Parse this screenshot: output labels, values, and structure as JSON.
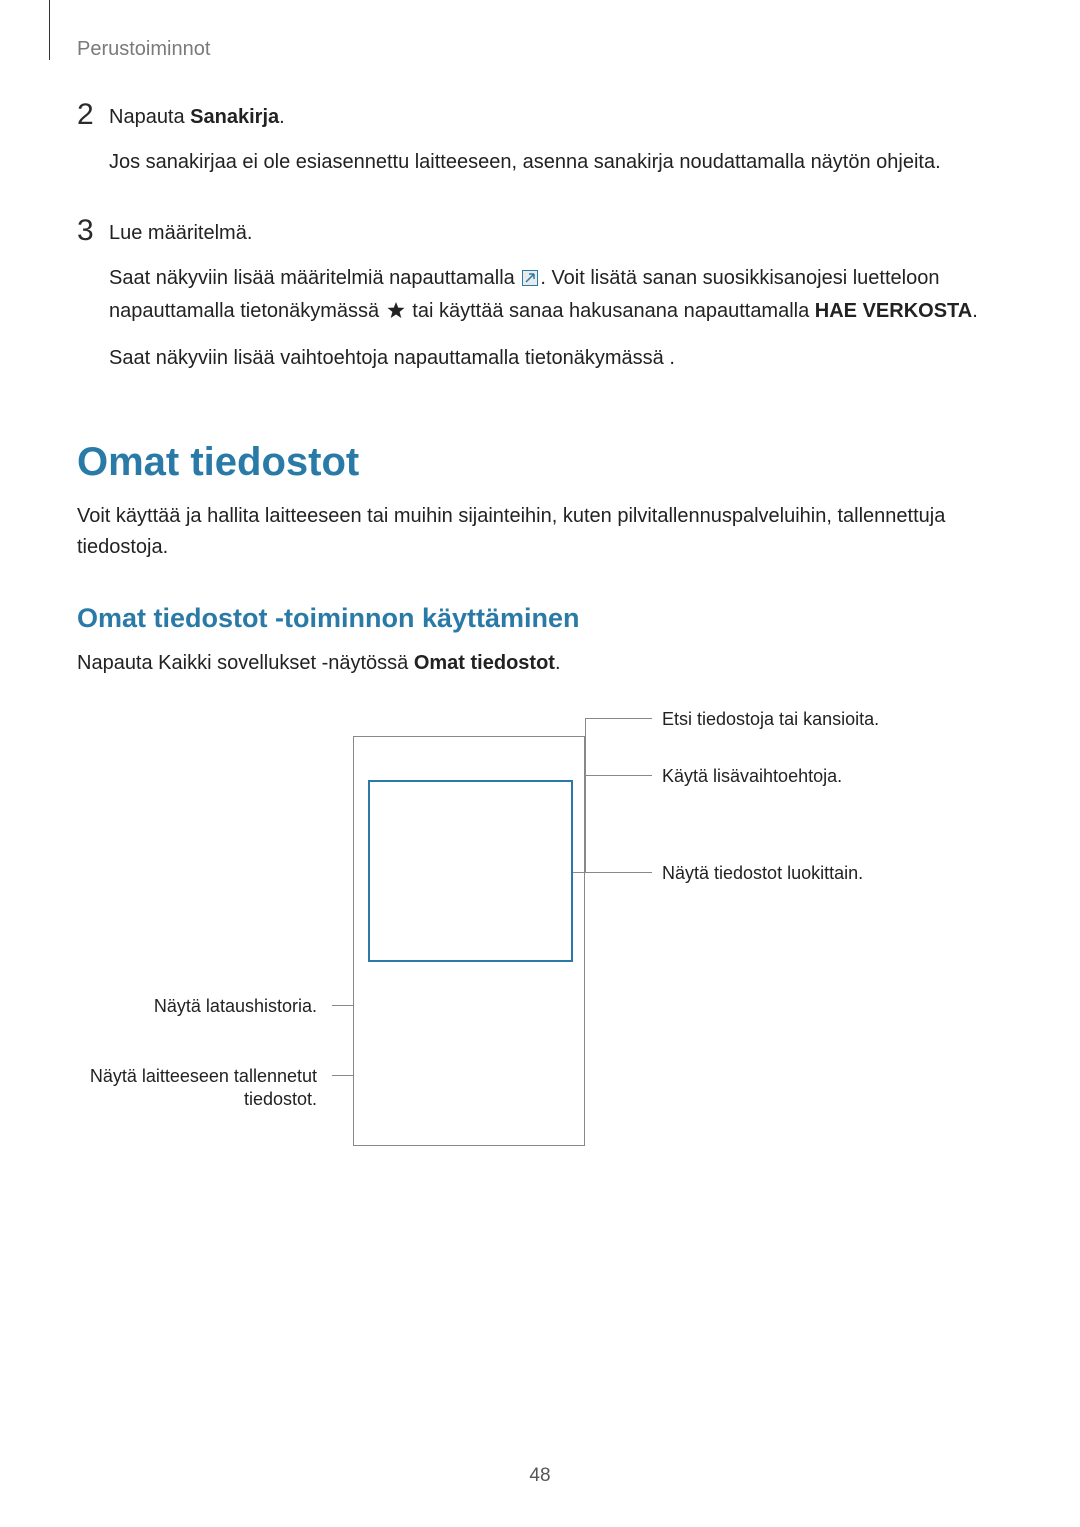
{
  "header": {
    "section": "Perustoiminnot"
  },
  "steps": [
    {
      "num": "2",
      "line1_pre": "Napauta ",
      "line1_bold": "Sanakirja",
      "line1_post": ".",
      "line2": "Jos sanakirjaa ei ole esiasennettu laitteeseen, asenna sanakirja noudattamalla näytön ohjeita."
    },
    {
      "num": "3",
      "line1": "Lue määritelmä.",
      "line2_a": "Saat näkyviin lisää määritelmiä napauttamalla ",
      "line2_b": ". Voit lisätä sanan suosikkisanojesi luetteloon napauttamalla tietonäkymässä ",
      "line2_c": " tai käyttää sanaa hakusanana napauttamalla ",
      "line2_bold": "HAE VERKOSTA",
      "line2_d": ".",
      "line3": "Saat näkyviin lisää vaihtoehtoja napauttamalla tietonäkymässä  ."
    }
  ],
  "section1": {
    "title": "Omat tiedostot",
    "body": "Voit käyttää ja hallita laitteeseen tai muihin sijainteihin, kuten pilvitallennuspalveluihin, tallennettuja tiedostoja."
  },
  "section2": {
    "title": "Omat tiedostot -toiminnon käyttäminen",
    "body_pre": "Napauta Kaikki sovellukset -näytössä ",
    "body_bold": "Omat tiedostot",
    "body_post": "."
  },
  "diagram": {
    "left1": "Näytä lataushistoria.",
    "left2a": "Näytä laitteeseen tallennetut",
    "left2b": "tiedostot.",
    "right1": "Etsi tiedostoja tai kansioita.",
    "right2": "Käytä lisävaihtoehtoja.",
    "right3": "Näytä tiedostot luokittain."
  },
  "page": "48"
}
